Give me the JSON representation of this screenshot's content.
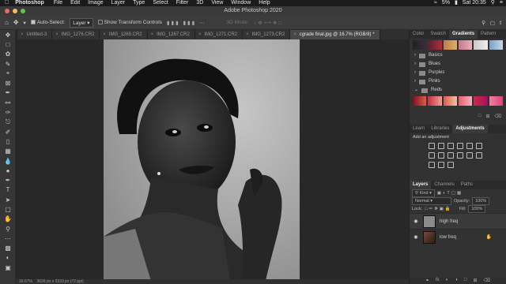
{
  "menubar": {
    "apple": "",
    "app": "Photoshop",
    "items": [
      "File",
      "Edit",
      "Image",
      "Layer",
      "Type",
      "Select",
      "Filter",
      "3D",
      "View",
      "Window",
      "Help"
    ],
    "battery": "5%",
    "clock": "Sat 20:35"
  },
  "window": {
    "title": "Adobe Photoshop 2020"
  },
  "options": {
    "auto_select_label": "Auto-Select:",
    "auto_select_target": "Layer",
    "transform_label": "Show Transform Controls",
    "mode_label": "3D Mode:"
  },
  "tabs": [
    {
      "label": "Untitled-3"
    },
    {
      "label": "IMG_1276.CR2"
    },
    {
      "label": "IMG_1269.CR2"
    },
    {
      "label": "IMG_1267.CR2"
    },
    {
      "label": "IMG_1271.CR2"
    },
    {
      "label": "IMG_1273.CR2"
    },
    {
      "label": "cgrade final.jpg @ 16.7% (RGB/8) *"
    }
  ],
  "status": {
    "zoom": "16.67%",
    "size": "3626 px x 3333 px (72 ppi)"
  },
  "panels": {
    "top_tabs": [
      "Color",
      "Swatch",
      "Gradients",
      "Pattern"
    ],
    "gradient_folders": [
      "Basics",
      "Blues",
      "Purples",
      "Pinks",
      "Reds"
    ],
    "mid_tabs": [
      "Learn",
      "Libraries",
      "Adjustments"
    ],
    "adjustments_hint": "Add an adjustment",
    "layer_tabs": [
      "Layers",
      "Channels",
      "Paths"
    ],
    "kind": "Kind",
    "blend_mode": "Normal",
    "opacity_label": "Opacity:",
    "opacity": "100%",
    "lock_label": "Lock:",
    "fill_label": "Fill:",
    "fill": "100%",
    "layers": [
      {
        "name": "high freq"
      },
      {
        "name": "low freq"
      }
    ]
  },
  "colors": {
    "swatches_top": [
      "#3b2b3b",
      "#5a2030",
      "#ad2d3b",
      "#c8794a",
      "#d9b16a",
      "#c47a8a",
      "#c8c8c8",
      "#7aa0c8"
    ],
    "swatches_reds": [
      "#7a1020",
      "#c03040",
      "#e05a4a",
      "#e46070",
      "#d02848",
      "#f080a0"
    ]
  }
}
